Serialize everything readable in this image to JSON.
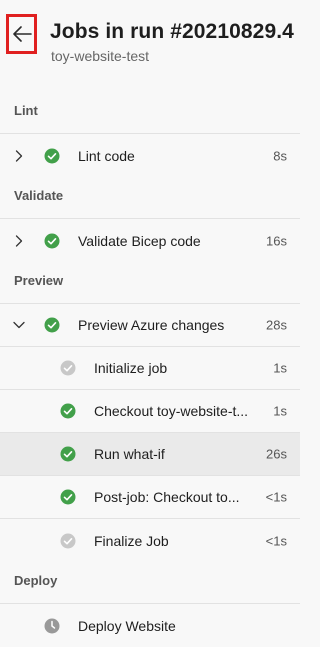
{
  "header": {
    "title": "Jobs in run #20210829.4",
    "subtitle": "toy-website-test"
  },
  "colors": {
    "success": "#42a04a",
    "skipped": "#c8c8c8",
    "pending": "#999999",
    "highlight_border": "#e02020",
    "selected_row": "#eaeaea"
  },
  "stages": [
    {
      "name": "Lint",
      "jobs": [
        {
          "label": "Lint code",
          "duration": "8s",
          "status": "success",
          "expanded": false
        }
      ]
    },
    {
      "name": "Validate",
      "jobs": [
        {
          "label": "Validate Bicep code",
          "duration": "16s",
          "status": "success",
          "expanded": false
        }
      ]
    },
    {
      "name": "Preview",
      "jobs": [
        {
          "label": "Preview Azure changes",
          "duration": "28s",
          "status": "success",
          "expanded": true,
          "steps": [
            {
              "label": "Initialize job",
              "duration": "1s",
              "status": "skipped"
            },
            {
              "label": "Checkout toy-website-t...",
              "duration": "1s",
              "status": "success"
            },
            {
              "label": "Run what-if",
              "duration": "26s",
              "status": "success",
              "selected": true
            },
            {
              "label": "Post-job: Checkout to...",
              "duration": "<1s",
              "status": "success"
            },
            {
              "label": "Finalize Job",
              "duration": "<1s",
              "status": "skipped"
            }
          ]
        }
      ]
    },
    {
      "name": "Deploy",
      "jobs": [
        {
          "label": "Deploy Website",
          "duration": "",
          "status": "pending",
          "expanded": false
        }
      ]
    }
  ],
  "icons": {
    "back": "arrow-left-icon",
    "collapsed": "chevron-right-icon",
    "expanded": "chevron-down-icon",
    "success": "check-circle-icon",
    "skipped": "check-circle-gray-icon",
    "pending": "clock-icon"
  }
}
